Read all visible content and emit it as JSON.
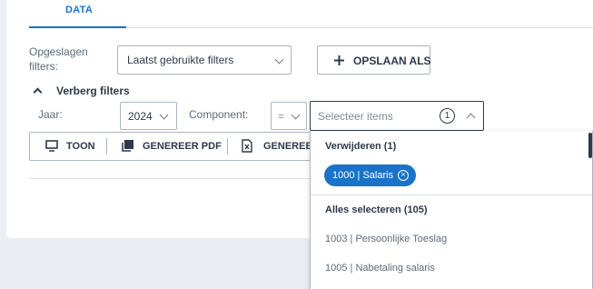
{
  "tabs": [
    {
      "label": "DATA"
    }
  ],
  "saved_filters": {
    "label": "Opgeslagen filters:",
    "selected": "Laatst gebruikte filters",
    "save_as_label": "OPSLAAN ALS"
  },
  "filters_toggle_label": "Verberg filters",
  "year": {
    "label": "Jaar:",
    "value": "2024"
  },
  "component": {
    "label": "Component:",
    "operator": "=",
    "placeholder": "Selecteer items",
    "count": "1"
  },
  "toolbar": {
    "show_label": "TOON",
    "pdf_label": "GENEREER PDF",
    "excel_label": "GENEREER EXCEL"
  },
  "dropdown": {
    "remove_header": "Verwijderen (1)",
    "selected_chips": [
      "1000 | Salaris"
    ],
    "select_all_label": "Alles selecteren (105)",
    "options": [
      "1003 | Persoonlijke Toeslag",
      "1005 | Nabetaling salaris"
    ]
  },
  "colors": {
    "accent": "#1a73c8",
    "text": "#2c3a4a",
    "border": "#aab6c3",
    "background": "#eaedf1"
  }
}
